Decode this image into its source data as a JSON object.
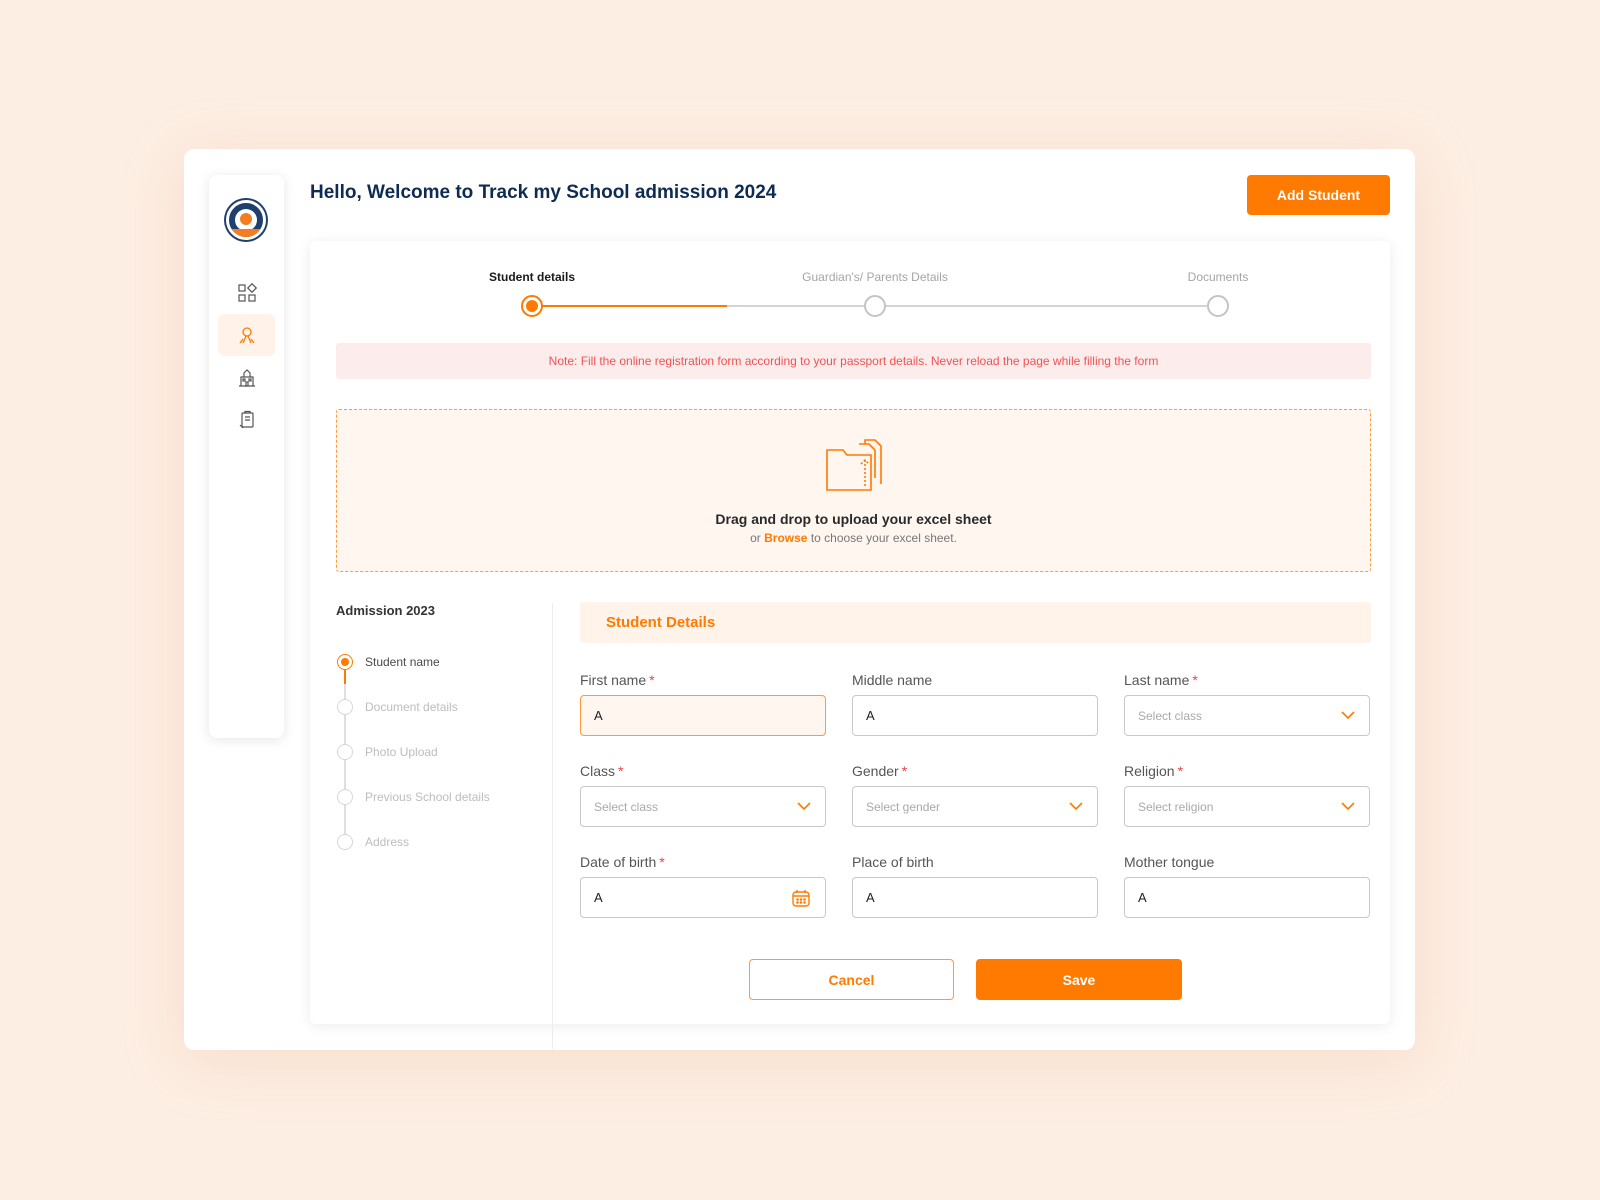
{
  "header": {
    "greeting": "Hello, Welcome to Track my School admission 2024",
    "add_button": "Add Student"
  },
  "sidebar": {
    "items": [
      {
        "icon": "dashboard-icon",
        "active": false
      },
      {
        "icon": "student-icon",
        "active": true
      },
      {
        "icon": "school-building-icon",
        "active": false
      },
      {
        "icon": "clipboard-icon",
        "active": false
      }
    ]
  },
  "stepper": {
    "steps": [
      {
        "label": "Student details",
        "active": true
      },
      {
        "label": "Guardian's/ Parents Details",
        "active": false
      },
      {
        "label": "Documents",
        "active": false
      }
    ]
  },
  "note": "Note: Fill the online registration form according to  your passport details. Never reload the page while filling the form",
  "upload": {
    "title": "Drag and drop to upload your excel sheet",
    "prefix": "or",
    "browse": "Browse",
    "suffix": "to choose your excel sheet."
  },
  "left_panel": {
    "title": "Admission 2023",
    "items": [
      {
        "label": "Student name",
        "active": true
      },
      {
        "label": "Document details",
        "active": false
      },
      {
        "label": "Photo Upload",
        "active": false
      },
      {
        "label": "Previous School details",
        "active": false
      },
      {
        "label": "Address",
        "active": false
      }
    ]
  },
  "form": {
    "section_title": "Student Details",
    "first_name": {
      "label": "First name",
      "value": "A"
    },
    "middle_name": {
      "label": "Middle name",
      "value": "A"
    },
    "last_name": {
      "label": "Last name",
      "placeholder": "Select class"
    },
    "class": {
      "label": "Class",
      "placeholder": "Select class"
    },
    "gender": {
      "label": "Gender",
      "placeholder": "Select gender"
    },
    "religion": {
      "label": "Religion",
      "placeholder": "Select religion"
    },
    "dob": {
      "label": "Date of birth",
      "value": "A"
    },
    "place_of_birth": {
      "label": "Place of birth",
      "value": "A"
    },
    "mother_tongue": {
      "label": "Mother tongue",
      "value": "A"
    },
    "required_mark": "*",
    "cancel": "Cancel",
    "save": "Save"
  },
  "colors": {
    "accent": "#ff7a00",
    "title": "#0e2c52",
    "note_text": "#f05252",
    "background": "#fdeee3"
  }
}
